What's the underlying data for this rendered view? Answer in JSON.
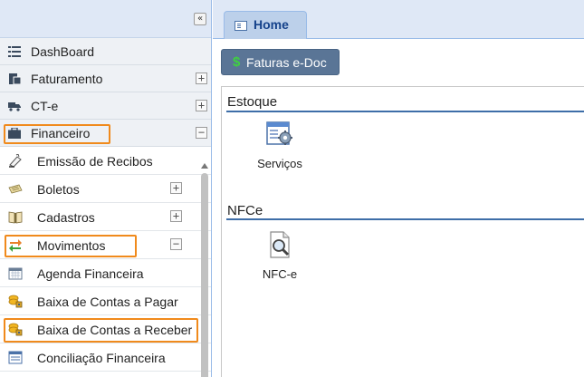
{
  "sidebar": {
    "collapse_glyph": "«",
    "top_items": [
      {
        "label": "DashBoard",
        "icon": "list-icon",
        "expandable": false
      },
      {
        "label": "Faturamento",
        "icon": "document-icon",
        "expandable": true,
        "toggle": "+"
      },
      {
        "label": "CT-e",
        "icon": "truck-icon",
        "expandable": true,
        "toggle": "+"
      },
      {
        "label": "Financeiro",
        "icon": "briefcase-icon",
        "expandable": true,
        "toggle": "−",
        "highlighted": true
      }
    ],
    "sub_items": [
      {
        "label": "Emissão de Recibos",
        "icon": "receipt-icon"
      },
      {
        "label": "Boletos",
        "icon": "ticket-icon",
        "toggle": "+"
      },
      {
        "label": "Cadastros",
        "icon": "book-icon",
        "toggle": "+"
      },
      {
        "label": "Movimentos",
        "icon": "transfer-arrows-icon",
        "toggle": "−",
        "highlighted": true
      },
      {
        "label": "Agenda Financeira",
        "icon": "calendar-icon"
      },
      {
        "label": "Baixa de Contas a Pagar",
        "icon": "coins-lock-icon"
      },
      {
        "label": "Baixa de Contas a Receber",
        "icon": "coins-lock-icon",
        "highlighted": true
      },
      {
        "label": "Conciliação Financeira",
        "icon": "window-list-icon"
      }
    ]
  },
  "main": {
    "tabs": [
      {
        "label": "Home",
        "icon": "home-tab-icon",
        "active": true
      }
    ],
    "toolbar": {
      "faturas_symbol": "$",
      "faturas_label": "Faturas e-Doc"
    },
    "sections": [
      {
        "title": "Estoque",
        "shortcuts": [
          {
            "label": "Serviços",
            "icon": "services-gear-icon"
          }
        ]
      },
      {
        "title": "NFCe",
        "shortcuts": [
          {
            "label": "NFC-e",
            "icon": "document-search-icon"
          }
        ]
      }
    ]
  },
  "colors": {
    "highlight": "#f08a1c",
    "section_line": "#3e6ea8",
    "tab_text": "#15428b",
    "button_bg": "#5a7596",
    "dollar": "#3fd13f"
  }
}
